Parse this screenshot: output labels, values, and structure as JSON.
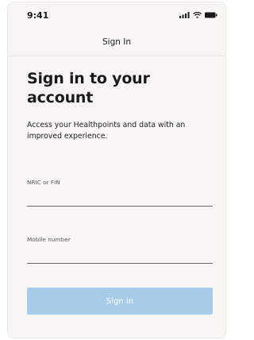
{
  "status_bar": {
    "time": "9:41",
    "icons": [
      "signal-icon",
      "wifi-icon",
      "battery-icon"
    ]
  },
  "nav": {
    "title": "Sign In"
  },
  "main": {
    "heading": "Sign in to your account",
    "subtitle": "Access your Healthpoints and data with an improved experience."
  },
  "form": {
    "nric_label": "NRIC or FIN",
    "nric_value": "",
    "mobile_label": "Mobile number",
    "mobile_value": "",
    "submit_label": "Sign in"
  },
  "colors": {
    "background": "#f7f6f3",
    "button_disabled": "#a7cce9",
    "text": "#1b1b1b"
  }
}
